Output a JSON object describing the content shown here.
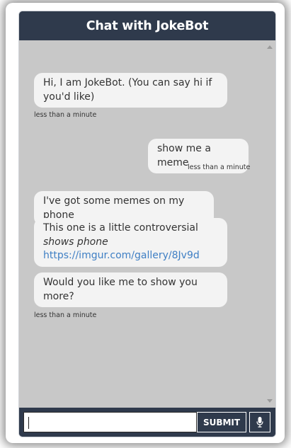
{
  "header": {
    "title": "Chat with JokeBot"
  },
  "messages": [
    {
      "from": "bot",
      "text": "Hi, I am JokeBot. (You can say hi if you'd like)",
      "time": "less than a minute"
    },
    {
      "from": "user",
      "text": "show me a meme",
      "time": "less than a minute"
    },
    {
      "from": "bot",
      "text": "I've got some memes on my phone"
    },
    {
      "from": "bot",
      "text": "This one is a little controversial",
      "action": "shows phone",
      "link": "https://imgur.com/gallery/8Jv9d"
    },
    {
      "from": "bot",
      "text": "Would you like me to show you more?",
      "time": "less than a minute"
    }
  ],
  "input": {
    "value": "",
    "placeholder": ""
  },
  "controls": {
    "submit_label": "SUBMIT",
    "mic_icon": "microphone-icon"
  },
  "colors": {
    "header": "#2f3a4c",
    "chat_bg": "#c8c8c8",
    "bubble": "#f3f3f3",
    "link": "#3f7fc4"
  }
}
